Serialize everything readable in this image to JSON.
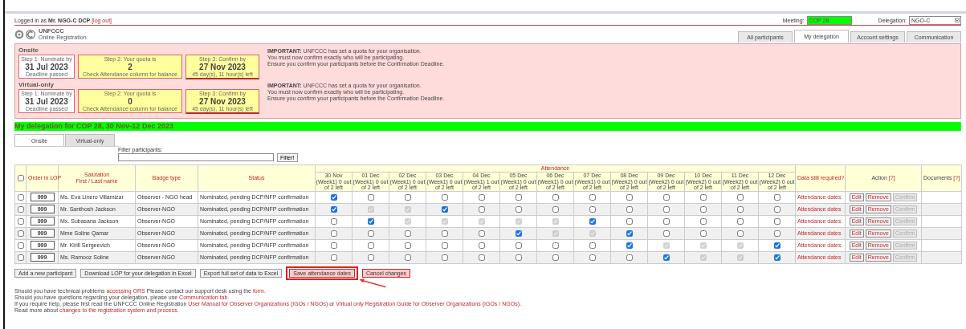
{
  "header": {
    "login": "Logged in as **Mr. NGO-C DCP**",
    "logout": "[log out]",
    "meeting_label": "Meeting:",
    "meeting": "COP 28",
    "delegation_label": "Delegation:",
    "delegation": "NGO-C"
  },
  "logo": {
    "title": "UNFCCC",
    "subtitle": "Online Registration"
  },
  "nav_tabs": [
    {
      "label": "All participants",
      "selected": false
    },
    {
      "label": "My delegation",
      "selected": true
    },
    {
      "label": "Account settings",
      "selected": false
    },
    {
      "label": "Communication",
      "selected": false
    }
  ],
  "quota_sections": [
    {
      "title": "Onsite",
      "steps": [
        {
          "kind": "passed",
          "caption": "Step 1: Nominate by",
          "value": "31 Jul 2023",
          "note": "Deadline passed"
        },
        {
          "kind": "quota",
          "caption": "Step 2: Your quota is",
          "value": "2",
          "note": "Check Attendance column for balance"
        },
        {
          "kind": "confirm",
          "caption": "Step 3: Confirm by",
          "value": "27 Nov 2023",
          "note": "45 day(s), 11 hour(s) left"
        }
      ],
      "notice": [
        "**IMPORTANT:** UNFCCC has set a quota for your organisation.",
        "You must now confirm exactly who will be participating.",
        "Ensure you confirm your participants before the Confirmation Deadline."
      ]
    },
    {
      "title": "Virtual-only",
      "steps": [
        {
          "kind": "passed",
          "caption": "Step 1: Nominate by",
          "value": "31 Jul 2023",
          "note": "Deadline passed"
        },
        {
          "kind": "quota",
          "caption": "Step 2: Your quota is",
          "value": "0",
          "note": "Check Attendance column for balance"
        },
        {
          "kind": "confirm",
          "caption": "Step 3: Confirm by",
          "value": "27 Nov 2023",
          "note": "45 day(s), 11 hour(s) left"
        }
      ],
      "notice": [
        "**IMPORTANT:** UNFCCC has set a quota for your organisation.",
        "You must now confirm exactly who will be participating.",
        "Ensure you confirm your participants before the Confirmation Deadline."
      ]
    }
  ],
  "delegation_title": "My delegation for COP 28, 30 Nov-12 Dec 2023",
  "mode_tabs": [
    {
      "label": "Onsite",
      "selected": true
    },
    {
      "label": "Virtual-only",
      "selected": false
    }
  ],
  "filter": {
    "label": "Filter participants:",
    "button": "Filter!"
  },
  "table": {
    "all_checked": false,
    "order_header": "Order in LOP",
    "name_header": [
      "Salutation",
      "First / Last name"
    ],
    "badge_header": "Badge type",
    "status_header": "Status",
    "attendance_header": "Attendance",
    "data_header": "Data still required?",
    "action_header": "Action",
    "action_help": "[?]",
    "documents_header": "Documents",
    "documents_help": "[?]",
    "days": [
      {
        "date": "30 Nov (Week1)",
        "left": "0 out of 2 left"
      },
      {
        "date": "01 Dec (Week1)",
        "left": "0 out of 2 left"
      },
      {
        "date": "02 Dec (Week1)",
        "left": "0 out of 2 left"
      },
      {
        "date": "03 Dec (Week1)",
        "left": "0 out of 2 left"
      },
      {
        "date": "04 Dec (Week1)",
        "left": "1 out of 2 left"
      },
      {
        "date": "05 Dec (Week1)",
        "left": "0 out of 2 left"
      },
      {
        "date": "06 Dec (Week1)",
        "left": "0 out of 2 left"
      },
      {
        "date": "07 Dec (Week1)",
        "left": "0 out of 2 left"
      },
      {
        "date": "08 Dec (Week2)",
        "left": "0 out of 2 left"
      },
      {
        "date": "09 Dec (Week2)",
        "left": "0 out of 2 left"
      },
      {
        "date": "10 Dec (Week2)",
        "left": "0 out of 2 left"
      },
      {
        "date": "11 Dec (Week2)",
        "left": "0 out of 2 left"
      },
      {
        "date": "12 Dec (Week2)",
        "left": "0 out of 2 left"
      }
    ],
    "rows": [
      {
        "checked": false,
        "order": "999",
        "name": "Ms. Eva Linero Villamizar",
        "badge": "Observer - NGO head",
        "status": "Nominated, pending DCP/NFP confirmation",
        "data_required": "Attendance dates",
        "actions": [
          {
            "label": "Edit",
            "disabled": false
          },
          {
            "label": "Remove",
            "disabled": false
          },
          {
            "label": "Confirm",
            "disabled": true
          }
        ],
        "attendance": [
          {
            "checked": true,
            "disabled": false
          },
          {
            "checked": false,
            "disabled": false
          },
          {
            "checked": false,
            "disabled": false
          },
          {
            "checked": false,
            "disabled": false
          },
          {
            "checked": false,
            "disabled": false
          },
          {
            "checked": false,
            "disabled": false
          },
          {
            "checked": false,
            "disabled": false
          },
          {
            "checked": false,
            "disabled": false
          },
          {
            "checked": false,
            "disabled": false
          },
          {
            "checked": false,
            "disabled": false
          },
          {
            "checked": false,
            "disabled": false
          },
          {
            "checked": false,
            "disabled": false
          },
          {
            "checked": false,
            "disabled": false
          }
        ]
      },
      {
        "checked": false,
        "order": "999",
        "name": "Mr. Santhosh Jackson",
        "badge": "Observer-NGO",
        "status": "Nominated, pending DCP/NFP confirmation",
        "data_required": "Attendance dates",
        "actions": [
          {
            "label": "Edit",
            "disabled": false
          },
          {
            "label": "Remove",
            "disabled": false
          },
          {
            "label": "Confirm",
            "disabled": true
          }
        ],
        "attendance": [
          {
            "checked": true,
            "disabled": false
          },
          {
            "checked": true,
            "disabled": true
          },
          {
            "checked": true,
            "disabled": true
          },
          {
            "checked": true,
            "disabled": false
          },
          {
            "checked": false,
            "disabled": false
          },
          {
            "checked": false,
            "disabled": false
          },
          {
            "checked": false,
            "disabled": false
          },
          {
            "checked": false,
            "disabled": false
          },
          {
            "checked": false,
            "disabled": false
          },
          {
            "checked": false,
            "disabled": false
          },
          {
            "checked": false,
            "disabled": false
          },
          {
            "checked": false,
            "disabled": false
          },
          {
            "checked": false,
            "disabled": false
          }
        ]
      },
      {
        "checked": false,
        "order": "999",
        "name": "Mx. Subasana Jackson",
        "badge": "Observer-NGO",
        "status": "Nominated, pending DCP/NFP confirmation",
        "data_required": "Attendance dates",
        "actions": [
          {
            "label": "Edit",
            "disabled": false
          },
          {
            "label": "Remove",
            "disabled": false
          },
          {
            "label": "Confirm",
            "disabled": true
          }
        ],
        "attendance": [
          {
            "checked": false,
            "disabled": false
          },
          {
            "checked": true,
            "disabled": false
          },
          {
            "checked": true,
            "disabled": true
          },
          {
            "checked": true,
            "disabled": true
          },
          {
            "checked": true,
            "disabled": true
          },
          {
            "checked": true,
            "disabled": true
          },
          {
            "checked": true,
            "disabled": true
          },
          {
            "checked": true,
            "disabled": false
          },
          {
            "checked": false,
            "disabled": false
          },
          {
            "checked": false,
            "disabled": false
          },
          {
            "checked": false,
            "disabled": false
          },
          {
            "checked": false,
            "disabled": false
          },
          {
            "checked": false,
            "disabled": false
          }
        ]
      },
      {
        "checked": false,
        "order": "999",
        "name": "Mme Soline Qamar",
        "badge": "Observer-NGO",
        "status": "Nominated, pending DCP/NFP confirmation",
        "data_required": "Attendance dates",
        "actions": [
          {
            "label": "Edit",
            "disabled": false
          },
          {
            "label": "Remove",
            "disabled": false
          },
          {
            "label": "Confirm",
            "disabled": true
          }
        ],
        "attendance": [
          {
            "checked": false,
            "disabled": false
          },
          {
            "checked": false,
            "disabled": false
          },
          {
            "checked": false,
            "disabled": false
          },
          {
            "checked": false,
            "disabled": false
          },
          {
            "checked": false,
            "disabled": false
          },
          {
            "checked": true,
            "disabled": false
          },
          {
            "checked": true,
            "disabled": true
          },
          {
            "checked": true,
            "disabled": true
          },
          {
            "checked": true,
            "disabled": false
          },
          {
            "checked": false,
            "disabled": false
          },
          {
            "checked": false,
            "disabled": false
          },
          {
            "checked": false,
            "disabled": false
          },
          {
            "checked": false,
            "disabled": false
          }
        ]
      },
      {
        "checked": false,
        "order": "999",
        "name": "Mr. Kirill Sergeevich",
        "badge": "Observer-NGO",
        "status": "Nominated, pending DCP/NFP confirmation",
        "data_required": "Attendance dates",
        "actions": [
          {
            "label": "Edit",
            "disabled": false
          },
          {
            "label": "Remove",
            "disabled": false
          },
          {
            "label": "Confirm",
            "disabled": true
          }
        ],
        "attendance": [
          {
            "checked": false,
            "disabled": false
          },
          {
            "checked": false,
            "disabled": false
          },
          {
            "checked": false,
            "disabled": false
          },
          {
            "checked": false,
            "disabled": false
          },
          {
            "checked": false,
            "disabled": false
          },
          {
            "checked": false,
            "disabled": false
          },
          {
            "checked": false,
            "disabled": false
          },
          {
            "checked": false,
            "disabled": false
          },
          {
            "checked": true,
            "disabled": false
          },
          {
            "checked": true,
            "disabled": true
          },
          {
            "checked": true,
            "disabled": true
          },
          {
            "checked": true,
            "disabled": true
          },
          {
            "checked": true,
            "disabled": false
          }
        ]
      },
      {
        "checked": false,
        "order": "999",
        "name": "Ms. Ramooz Soline",
        "badge": "Observer-NGO",
        "status": "Nominated, pending DCP/NFP confirmation",
        "data_required": "Attendance dates",
        "actions": [
          {
            "label": "Edit",
            "disabled": false
          },
          {
            "label": "Remove",
            "disabled": false
          },
          {
            "label": "Confirm",
            "disabled": true
          }
        ],
        "attendance": [
          {
            "checked": false,
            "disabled": false
          },
          {
            "checked": false,
            "disabled": false
          },
          {
            "checked": false,
            "disabled": false
          },
          {
            "checked": false,
            "disabled": false
          },
          {
            "checked": false,
            "disabled": false
          },
          {
            "checked": false,
            "disabled": false
          },
          {
            "checked": false,
            "disabled": false
          },
          {
            "checked": false,
            "disabled": false
          },
          {
            "checked": false,
            "disabled": false
          },
          {
            "checked": true,
            "disabled": false
          },
          {
            "checked": true,
            "disabled": true
          },
          {
            "checked": true,
            "disabled": true
          },
          {
            "checked": true,
            "disabled": false
          }
        ]
      }
    ]
  },
  "buttons": [
    {
      "label": "Add a new participant",
      "kind": "plain",
      "highlighted": false
    },
    {
      "label": "Download LOP for your delegation in Excel",
      "kind": "plain",
      "highlighted": false
    },
    {
      "label": "Export full set of data to Excel",
      "kind": "plain",
      "highlighted": false
    },
    {
      "label": "Save attendance dates",
      "kind": "alert",
      "highlighted": true
    },
    {
      "label": "Cancel changes",
      "kind": "alert",
      "highlighted": false
    }
  ],
  "help": [
    [
      {
        "text": "Should you have technical problems ",
        "link": false
      },
      {
        "text": "accessing ORS",
        "link": true
      },
      {
        "text": " Please contact our support desk using the ",
        "link": false
      },
      {
        "text": "form",
        "link": true
      },
      {
        "text": "."
      }
    ],
    [
      {
        "text": "Should you have questions regarding your delegation, please use ",
        "link": false
      },
      {
        "text": "Communication tab",
        "link": true
      },
      {
        "text": "."
      }
    ],
    [
      {
        "text": "If you require help, please first read the UNFCCC Online Registration ",
        "link": false
      },
      {
        "text": "User Manual for Observer Organizations (IGOs / NGOs)",
        "link": true
      },
      {
        "text": " or ",
        "link": false
      },
      {
        "text": "Virtual only Registration Guide for Observer Organizations (IGOs / NGOs)",
        "link": true
      },
      {
        "text": "."
      }
    ],
    [
      {
        "text": "Read more about ",
        "link": false
      },
      {
        "text": "changes to the registration system and process",
        "link": true
      },
      {
        "text": "."
      }
    ]
  ]
}
